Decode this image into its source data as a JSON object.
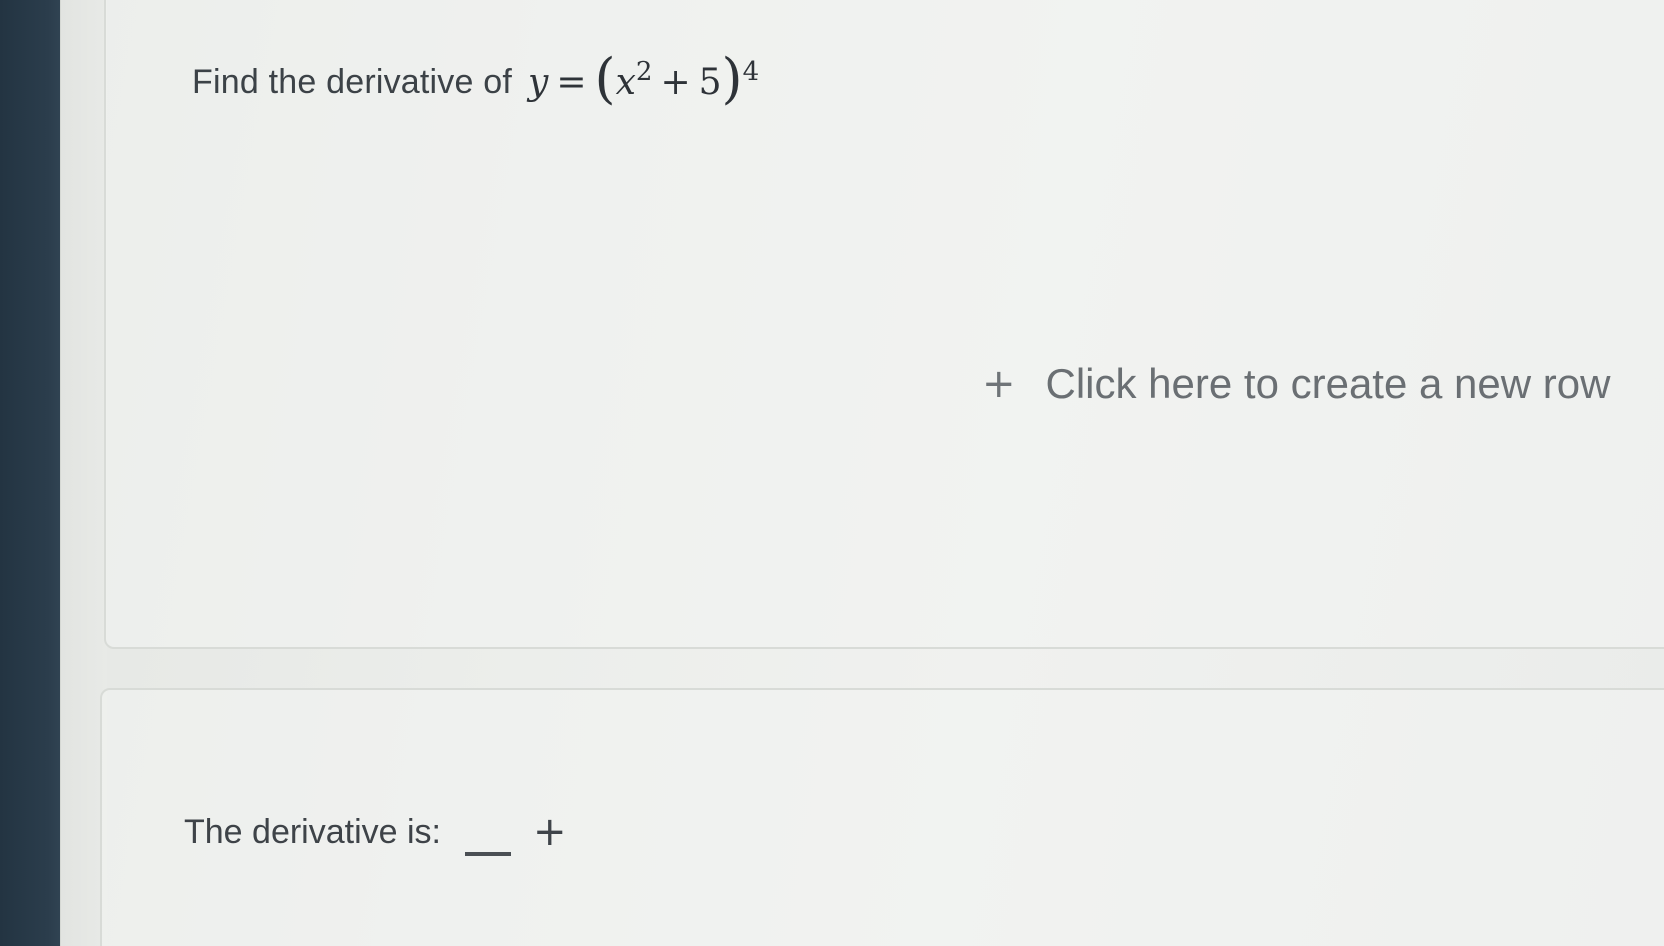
{
  "question": {
    "prompt": "Find the derivative of",
    "equation": {
      "lhs": "y",
      "equals": "=",
      "open_paren": "(",
      "base_var": "x",
      "base_exp": "2",
      "op": "+",
      "constant": "5",
      "close_paren": ")",
      "outer_exp": "4"
    }
  },
  "workspace": {
    "new_row_icon": "plus-icon",
    "new_row_symbol": "+",
    "new_row_label": "Click here to create a new row"
  },
  "answer": {
    "label": "The derivative is:",
    "add_icon": "plus-icon",
    "add_symbol": "+"
  },
  "colors": {
    "sidebar": "#2b3d4c",
    "background": "#eceeeb",
    "text": "#3c4247",
    "muted_text": "#6a6f73"
  }
}
